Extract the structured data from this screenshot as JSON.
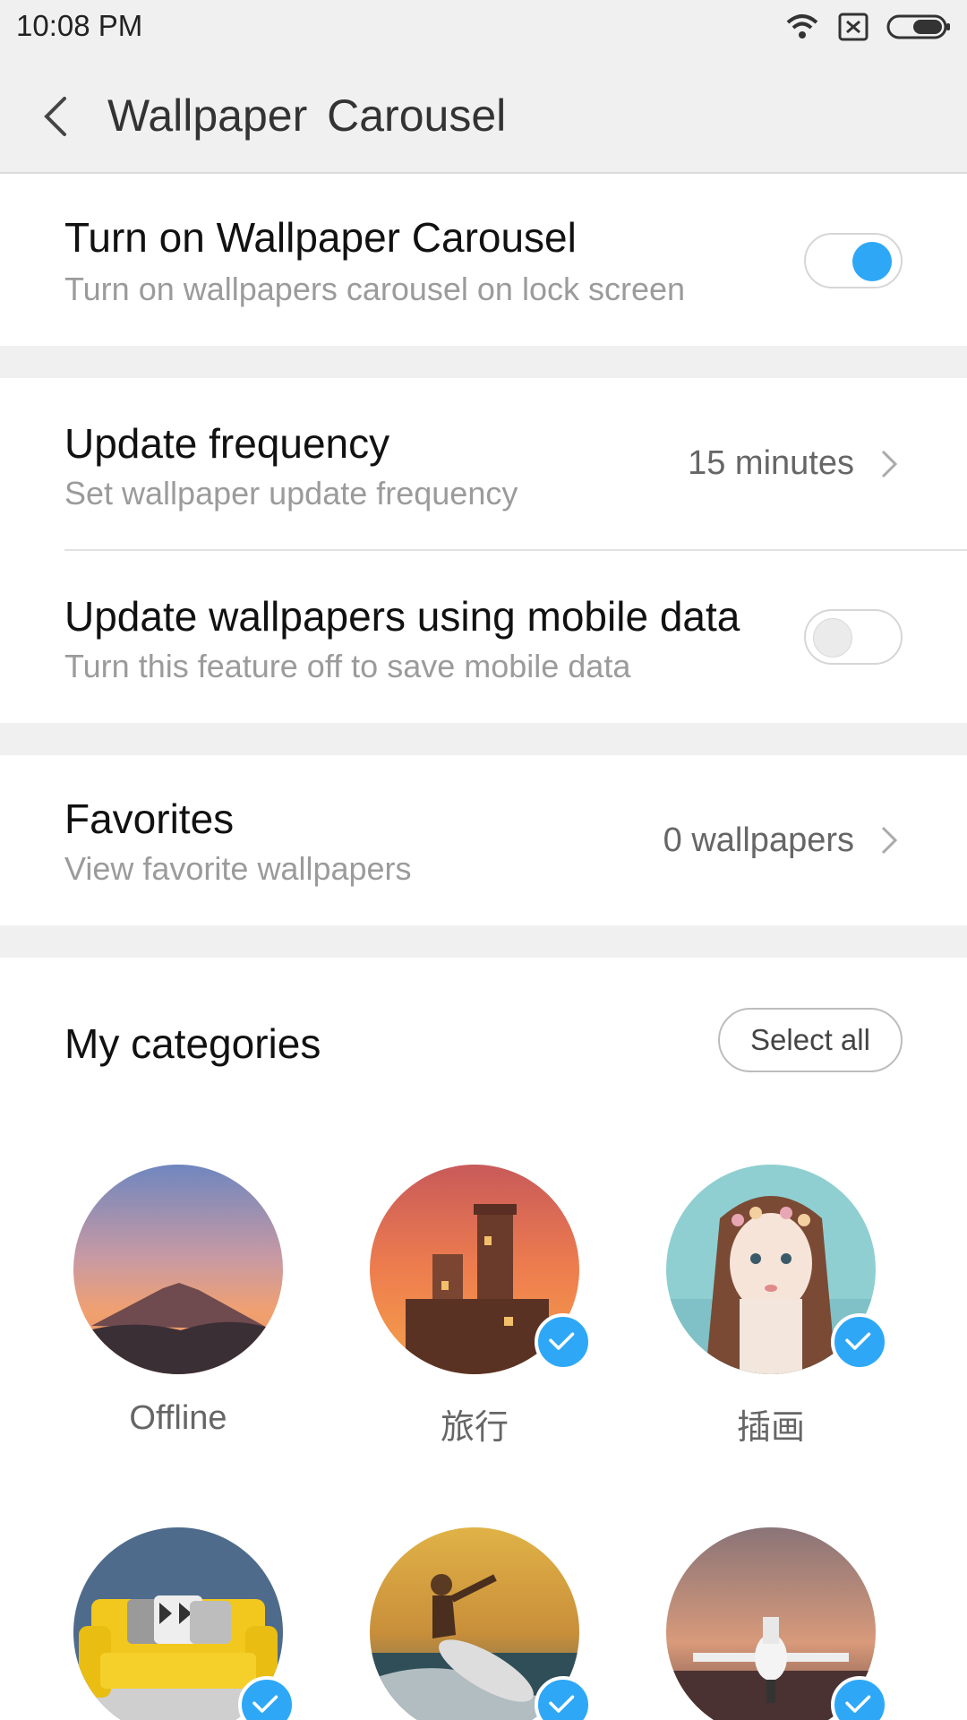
{
  "status_bar": {
    "time": "10:08 PM"
  },
  "header": {
    "title": "Wallpaper  Carousel"
  },
  "carousel": {
    "title": "Turn on Wallpaper Carousel",
    "subtitle": "Turn on wallpapers carousel on lock screen",
    "enabled": true
  },
  "frequency": {
    "title": "Update frequency",
    "subtitle": "Set wallpaper update frequency",
    "value": "15 minutes"
  },
  "mobile_data": {
    "title": "Update wallpapers using mobile data",
    "subtitle": "Turn this feature off to save mobile data",
    "enabled": false
  },
  "favorites": {
    "title": "Favorites",
    "subtitle": "View favorite wallpapers",
    "value": "0 wallpapers"
  },
  "categories": {
    "title": "My categories",
    "select_all_label": "Select all",
    "items": [
      {
        "label": "Offline",
        "selected": false,
        "image": "mountain-sunset"
      },
      {
        "label": "旅行",
        "selected": true,
        "image": "castle-sunset"
      },
      {
        "label": "插画",
        "selected": true,
        "image": "illustrated-girl"
      },
      {
        "label": "",
        "selected": true,
        "image": "yellow-sofa"
      },
      {
        "label": "",
        "selected": true,
        "image": "surfer"
      },
      {
        "label": "",
        "selected": true,
        "image": "private-jet"
      }
    ]
  },
  "colors": {
    "accent": "#2ea8f6",
    "background_gray": "#f0f0f0"
  }
}
